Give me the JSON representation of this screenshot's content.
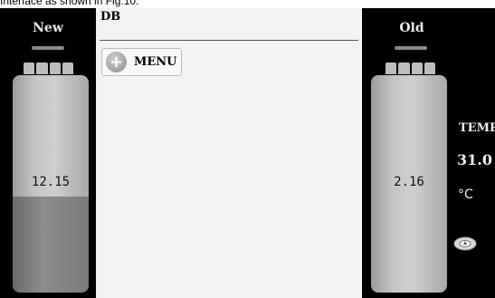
{
  "caption": "Interface as shown in Fig.10.",
  "left_tank": {
    "title": "New",
    "value": "12.15",
    "fill_fraction": 0.44
  },
  "right_tank": {
    "title": "Old",
    "value": "2.16",
    "fill_fraction": 0.0
  },
  "center_panel": {
    "title": "DB",
    "menu_button": {
      "label": "MENU",
      "icon": "plus-circle-icon"
    }
  },
  "temperature": {
    "label": "TEMP",
    "value": "31.0",
    "unit": "°C",
    "icon": "drop-icon"
  },
  "colors": {
    "panel_background": "#000000",
    "center_background": "#f3f3f3",
    "tank_light": "#c6c6c6",
    "tank_fill": "#7a7a7a"
  }
}
